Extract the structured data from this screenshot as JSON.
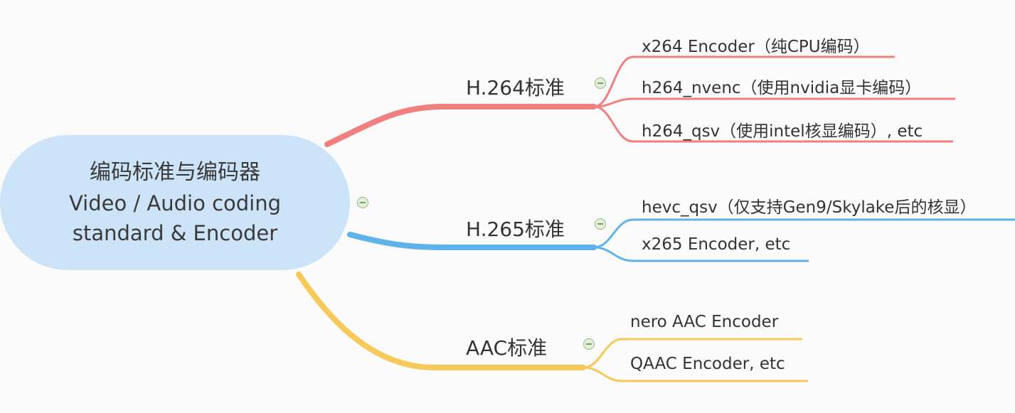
{
  "root": {
    "title": "编码标准与编码器",
    "subtitle_line1": "Video / Audio coding",
    "subtitle_line2": "standard & Encoder"
  },
  "branches": [
    {
      "label": "H.264标准",
      "color": "#f07f80",
      "leaves": [
        "x264 Encoder（纯CPU编码）",
        "h264_nvenc（使用nvidia显卡编码）",
        "h264_qsv（使用intel核显编码）, etc"
      ]
    },
    {
      "label": "H.265标准",
      "color": "#5fb3ea",
      "leaves": [
        "hevc_qsv（仅支持Gen9/Skylake后的核显）",
        "x265 Encoder, etc"
      ]
    },
    {
      "label": "AAC标准",
      "color": "#f7c85a",
      "leaves": [
        "nero AAC Encoder",
        "QAAC Encoder, etc"
      ]
    }
  ],
  "icons": {
    "collapse": "collapse-minus-icon"
  }
}
